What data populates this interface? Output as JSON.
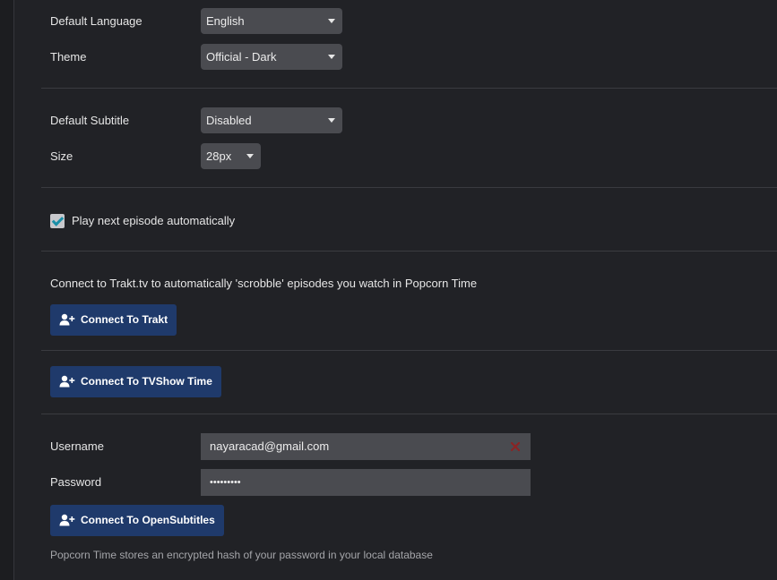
{
  "language": {
    "label": "Default Language",
    "value": "English"
  },
  "theme": {
    "label": "Theme",
    "value": "Official - Dark"
  },
  "subtitle": {
    "label": "Default Subtitle",
    "value": "Disabled"
  },
  "size": {
    "label": "Size",
    "value": "28px"
  },
  "playback": {
    "autoplay_label": "Play next episode automatically",
    "autoplay_checked": true
  },
  "trakt": {
    "description": "Connect to Trakt.tv to automatically 'scrobble' episodes you watch in Popcorn Time",
    "button_label": "Connect To Trakt"
  },
  "tvshowtime": {
    "button_label": "Connect To TVShow Time"
  },
  "opensubtitles": {
    "username_label": "Username",
    "username_value": "nayaracad@gmail.com",
    "password_label": "Password",
    "password_value": "•••••••••",
    "button_label": "Connect To OpenSubtitles",
    "note": "Popcorn Time stores an encrypted hash of your password in your local database"
  },
  "colors": {
    "background": "#212226",
    "control": "#4a4b50",
    "button": "#1f3a6b",
    "checkbox_tick": "#1a8fa8",
    "clear_x": "#8a2424"
  }
}
